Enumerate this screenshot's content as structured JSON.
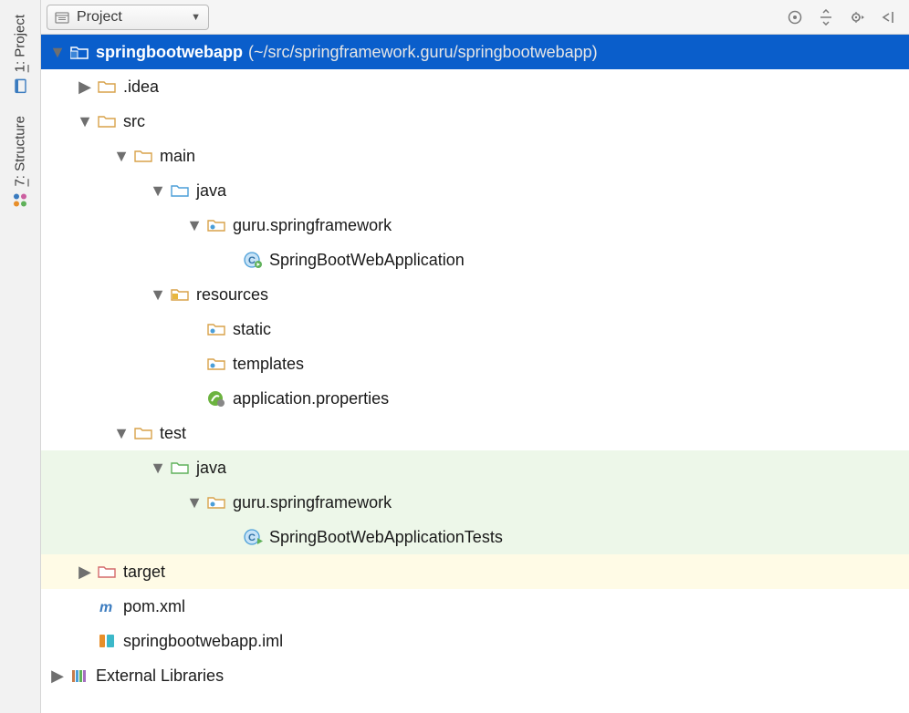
{
  "toolbar": {
    "view_label": "Project"
  },
  "sidebar": {
    "tab1_num": "1",
    "tab1_label": ": Project",
    "tab2_num": "7",
    "tab2_label": ": Structure"
  },
  "tree": {
    "root": {
      "name": "springbootwebapp",
      "path": "(~/src/springframework.guru/springbootwebapp)"
    },
    "idea": ".idea",
    "src": "src",
    "main": "main",
    "java_main": "java",
    "pkg_main": "guru.springframework",
    "class_main": "SpringBootWebApplication",
    "resources": "resources",
    "static": "static",
    "templates": "templates",
    "app_props": "application.properties",
    "test": "test",
    "java_test": "java",
    "pkg_test": "guru.springframework",
    "class_test": "SpringBootWebApplicationTests",
    "target": "target",
    "pom": "pom.xml",
    "iml": "springbootwebapp.iml",
    "ext_libs": "External Libraries"
  }
}
